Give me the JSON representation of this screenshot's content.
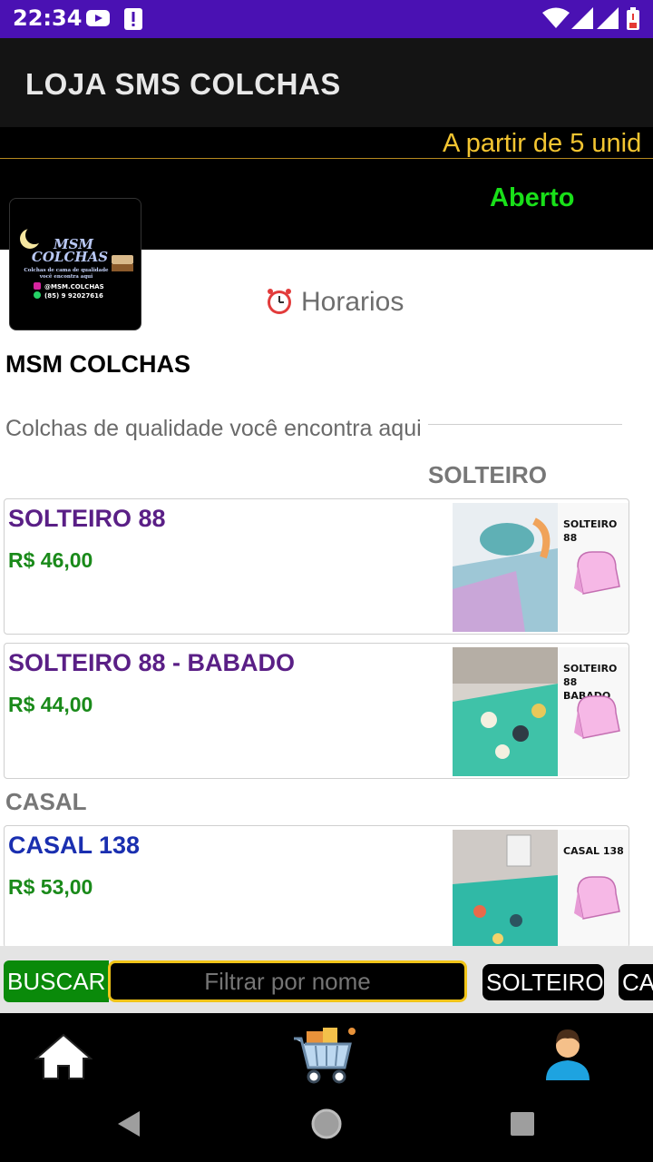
{
  "status_bar": {
    "time": "22:34"
  },
  "app_bar": {
    "title": "LOJA SMS COLCHAS"
  },
  "marquee": {
    "text": "A partir de 5 unid"
  },
  "store": {
    "open_status": "Aberto",
    "hours_label": "Horarios",
    "name": "MSM COLCHAS",
    "description": "Colchas de qualidade você encontra aqui",
    "logo": {
      "title_line1": "MSM",
      "title_line2": "COLCHAS",
      "tagline1": "Colchas de cama de qualidade",
      "tagline2": "você encontra aqui",
      "instagram": "@MSM.COLCHAS",
      "whatsapp": "(85) 9 92027616"
    }
  },
  "categories": [
    {
      "title": "SOLTEIRO",
      "products": [
        {
          "name": "SOLTEIRO 88",
          "price": "R$ 46,00",
          "caption_line1": "SOLTEIRO 88",
          "caption_line2": "",
          "name_color": "#5a1f86"
        },
        {
          "name": "SOLTEIRO 88 - BABADO",
          "price": "R$ 44,00",
          "caption_line1": "SOLTEIRO 88",
          "caption_line2": "BABADO",
          "name_color": "#5a1f86"
        }
      ]
    },
    {
      "title": "CASAL",
      "products": [
        {
          "name": "CASAL 138",
          "price": "R$ 53,00",
          "caption_line1": "CASAL 138",
          "caption_line2": "",
          "name_color": "#1a2fb0"
        }
      ]
    }
  ],
  "filter_bar": {
    "search_label": "BUSCAR",
    "placeholder": "Filtrar por nome",
    "chips": [
      "SOLTEIRO",
      "CA"
    ]
  },
  "colors": {
    "status_bar": "#4a11b3",
    "open_green": "#19e019",
    "price_green": "#1a8a1a",
    "marquee_yellow": "#f3c531"
  },
  "icons": {
    "bottom_nav": [
      "home-icon",
      "shopping-cart-icon",
      "user-icon"
    ],
    "system_nav": [
      "back-icon",
      "home-circle-icon",
      "recents-icon"
    ]
  }
}
